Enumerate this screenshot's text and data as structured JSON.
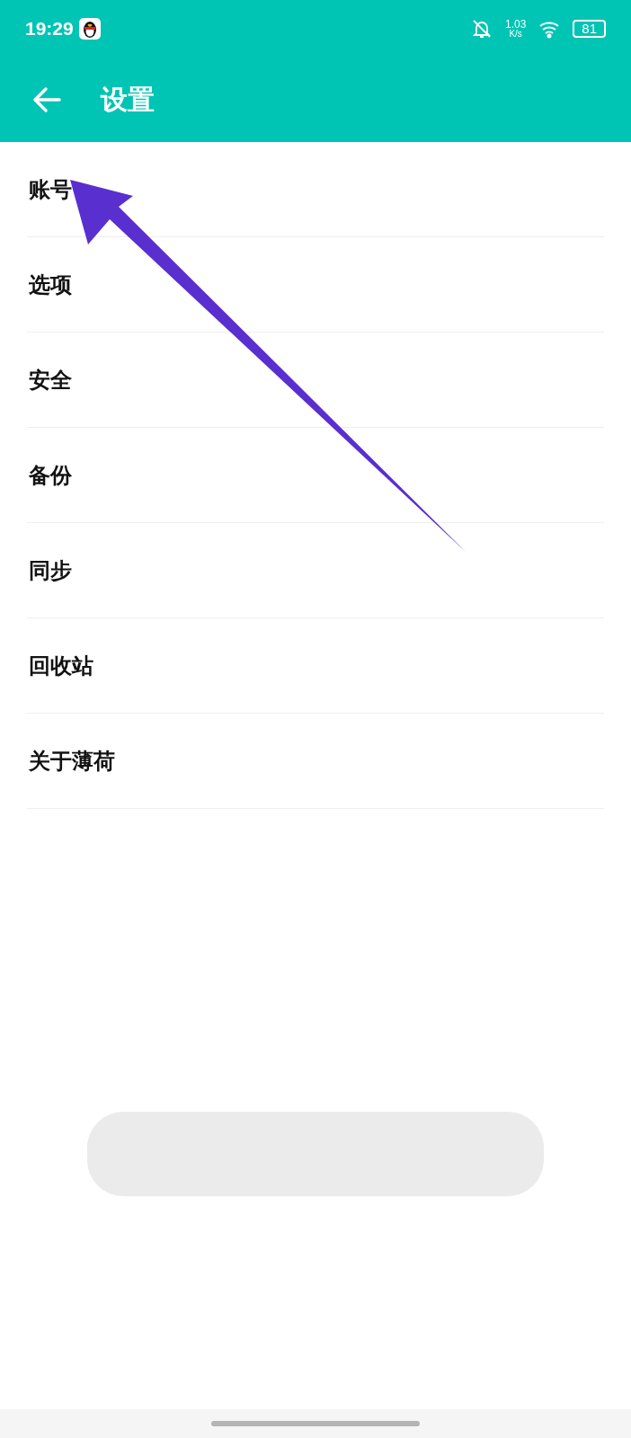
{
  "status_bar": {
    "time": "19:29",
    "speed": "1.03",
    "speed_unit": "K/s",
    "battery": "81"
  },
  "header": {
    "title": "设置"
  },
  "items": [
    {
      "label": "账号"
    },
    {
      "label": "选项"
    },
    {
      "label": "安全"
    },
    {
      "label": "备份"
    },
    {
      "label": "同步"
    },
    {
      "label": "回收站"
    },
    {
      "label": "关于薄荷"
    }
  ]
}
